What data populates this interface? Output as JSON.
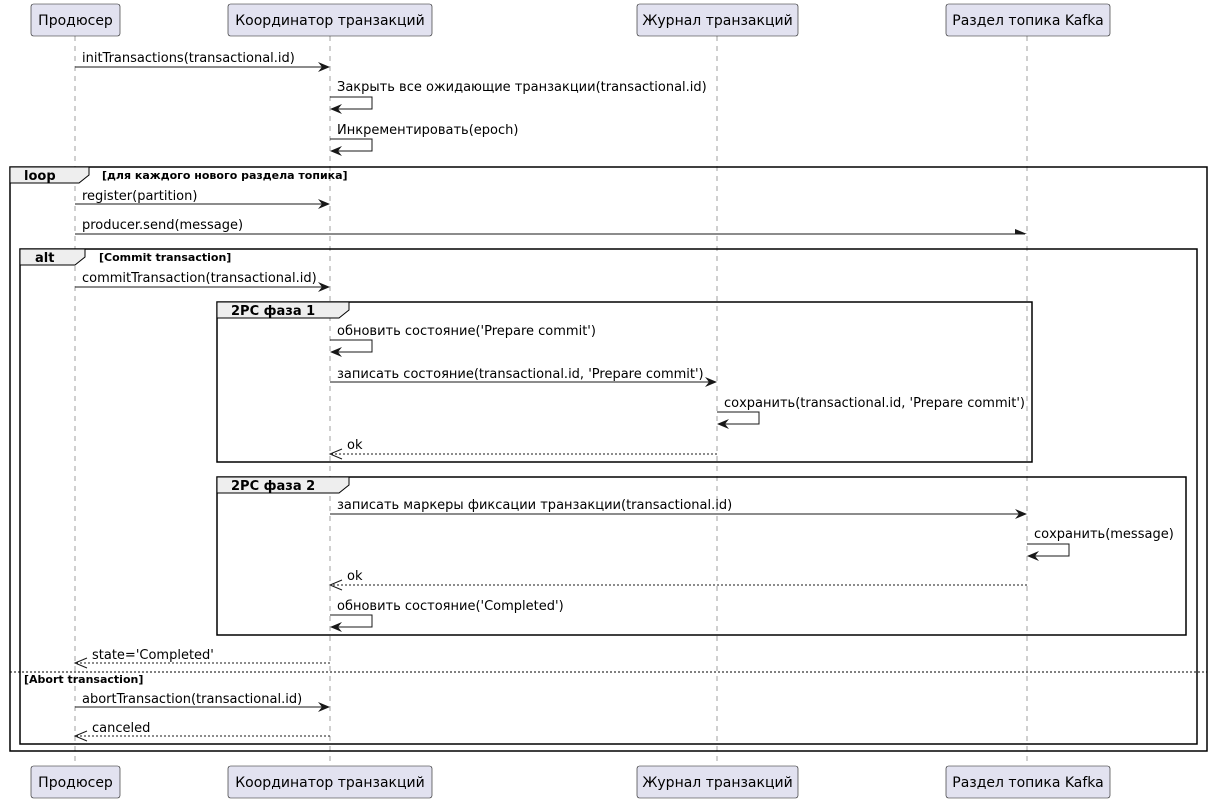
{
  "participants": [
    {
      "id": "producer",
      "label": "Продюсер"
    },
    {
      "id": "coordinator",
      "label": "Координатор транзакций"
    },
    {
      "id": "log",
      "label": "Журнал транзакций"
    },
    {
      "id": "partition",
      "label": "Раздел топика Kafka"
    }
  ],
  "fragments": {
    "loop": {
      "keyword": "loop",
      "guard": "[для каждого нового раздела топика]"
    },
    "alt": {
      "keyword": "alt",
      "guard": "[Commit transaction]",
      "else_guard": "[Abort transaction]"
    },
    "phase1": {
      "keyword": "2PC фаза 1"
    },
    "phase2": {
      "keyword": "2PC фаза 2"
    }
  },
  "messages": [
    {
      "from": "producer",
      "to": "coordinator",
      "label": "initTransactions(transactional.id)",
      "style": "solid"
    },
    {
      "from": "coordinator",
      "to": "coordinator",
      "label": "Закрыть все ожидающие транзакции(transactional.id)",
      "style": "solid"
    },
    {
      "from": "coordinator",
      "to": "coordinator",
      "label": "Инкрементировать(epoch)",
      "style": "solid"
    },
    {
      "from": "producer",
      "to": "coordinator",
      "label": "register(partition)",
      "style": "solid"
    },
    {
      "from": "producer",
      "to": "partition",
      "label": "producer.send(message)",
      "style": "async"
    },
    {
      "from": "producer",
      "to": "coordinator",
      "label": "commitTransaction(transactional.id)",
      "style": "solid"
    },
    {
      "from": "coordinator",
      "to": "coordinator",
      "label": "обновить состояние('Prepare commit')",
      "style": "solid"
    },
    {
      "from": "coordinator",
      "to": "log",
      "label": "записать состояние(transactional.id, 'Prepare commit')",
      "style": "solid"
    },
    {
      "from": "log",
      "to": "log",
      "label": "сохранить(transactional.id, 'Prepare commit')",
      "style": "solid"
    },
    {
      "from": "log",
      "to": "coordinator",
      "label": "ok",
      "style": "dashed"
    },
    {
      "from": "coordinator",
      "to": "partition",
      "label": "записать маркеры фиксации транзакции(transactional.id)",
      "style": "solid"
    },
    {
      "from": "partition",
      "to": "partition",
      "label": "сохранить(message)",
      "style": "solid"
    },
    {
      "from": "partition",
      "to": "coordinator",
      "label": "ok",
      "style": "dashed"
    },
    {
      "from": "coordinator",
      "to": "coordinator",
      "label": "обновить состояние('Completed')",
      "style": "solid"
    },
    {
      "from": "coordinator",
      "to": "producer",
      "label": "state='Completed'",
      "style": "dashed"
    },
    {
      "from": "producer",
      "to": "coordinator",
      "label": "abortTransaction(transactional.id)",
      "style": "solid"
    },
    {
      "from": "coordinator",
      "to": "producer",
      "label": "canceled",
      "style": "dashed"
    }
  ]
}
